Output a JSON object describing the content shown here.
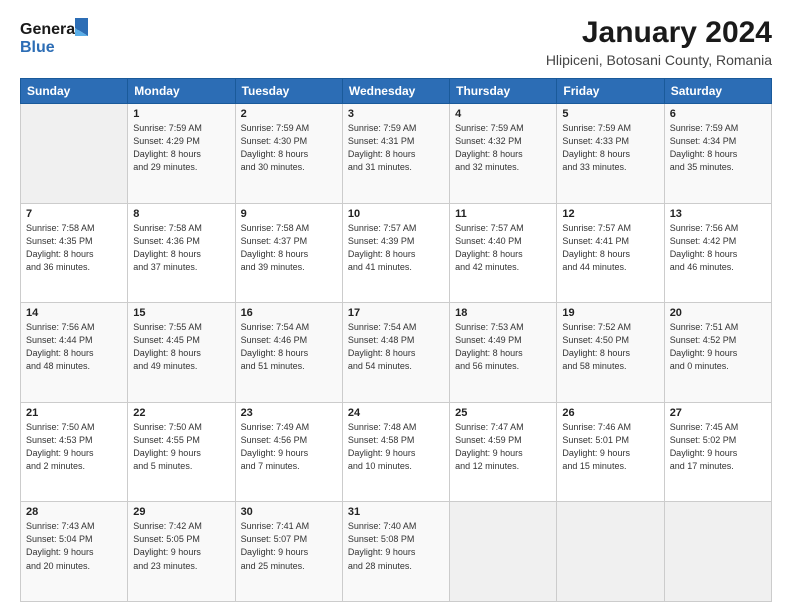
{
  "logo": {
    "line1": "General",
    "line2": "Blue"
  },
  "title": "January 2024",
  "subtitle": "Hlipiceni, Botosani County, Romania",
  "weekdays": [
    "Sunday",
    "Monday",
    "Tuesday",
    "Wednesday",
    "Thursday",
    "Friday",
    "Saturday"
  ],
  "weeks": [
    [
      {
        "day": "",
        "info": ""
      },
      {
        "day": "1",
        "info": "Sunrise: 7:59 AM\nSunset: 4:29 PM\nDaylight: 8 hours\nand 29 minutes."
      },
      {
        "day": "2",
        "info": "Sunrise: 7:59 AM\nSunset: 4:30 PM\nDaylight: 8 hours\nand 30 minutes."
      },
      {
        "day": "3",
        "info": "Sunrise: 7:59 AM\nSunset: 4:31 PM\nDaylight: 8 hours\nand 31 minutes."
      },
      {
        "day": "4",
        "info": "Sunrise: 7:59 AM\nSunset: 4:32 PM\nDaylight: 8 hours\nand 32 minutes."
      },
      {
        "day": "5",
        "info": "Sunrise: 7:59 AM\nSunset: 4:33 PM\nDaylight: 8 hours\nand 33 minutes."
      },
      {
        "day": "6",
        "info": "Sunrise: 7:59 AM\nSunset: 4:34 PM\nDaylight: 8 hours\nand 35 minutes."
      }
    ],
    [
      {
        "day": "7",
        "info": "Sunrise: 7:58 AM\nSunset: 4:35 PM\nDaylight: 8 hours\nand 36 minutes."
      },
      {
        "day": "8",
        "info": "Sunrise: 7:58 AM\nSunset: 4:36 PM\nDaylight: 8 hours\nand 37 minutes."
      },
      {
        "day": "9",
        "info": "Sunrise: 7:58 AM\nSunset: 4:37 PM\nDaylight: 8 hours\nand 39 minutes."
      },
      {
        "day": "10",
        "info": "Sunrise: 7:57 AM\nSunset: 4:39 PM\nDaylight: 8 hours\nand 41 minutes."
      },
      {
        "day": "11",
        "info": "Sunrise: 7:57 AM\nSunset: 4:40 PM\nDaylight: 8 hours\nand 42 minutes."
      },
      {
        "day": "12",
        "info": "Sunrise: 7:57 AM\nSunset: 4:41 PM\nDaylight: 8 hours\nand 44 minutes."
      },
      {
        "day": "13",
        "info": "Sunrise: 7:56 AM\nSunset: 4:42 PM\nDaylight: 8 hours\nand 46 minutes."
      }
    ],
    [
      {
        "day": "14",
        "info": "Sunrise: 7:56 AM\nSunset: 4:44 PM\nDaylight: 8 hours\nand 48 minutes."
      },
      {
        "day": "15",
        "info": "Sunrise: 7:55 AM\nSunset: 4:45 PM\nDaylight: 8 hours\nand 49 minutes."
      },
      {
        "day": "16",
        "info": "Sunrise: 7:54 AM\nSunset: 4:46 PM\nDaylight: 8 hours\nand 51 minutes."
      },
      {
        "day": "17",
        "info": "Sunrise: 7:54 AM\nSunset: 4:48 PM\nDaylight: 8 hours\nand 54 minutes."
      },
      {
        "day": "18",
        "info": "Sunrise: 7:53 AM\nSunset: 4:49 PM\nDaylight: 8 hours\nand 56 minutes."
      },
      {
        "day": "19",
        "info": "Sunrise: 7:52 AM\nSunset: 4:50 PM\nDaylight: 8 hours\nand 58 minutes."
      },
      {
        "day": "20",
        "info": "Sunrise: 7:51 AM\nSunset: 4:52 PM\nDaylight: 9 hours\nand 0 minutes."
      }
    ],
    [
      {
        "day": "21",
        "info": "Sunrise: 7:50 AM\nSunset: 4:53 PM\nDaylight: 9 hours\nand 2 minutes."
      },
      {
        "day": "22",
        "info": "Sunrise: 7:50 AM\nSunset: 4:55 PM\nDaylight: 9 hours\nand 5 minutes."
      },
      {
        "day": "23",
        "info": "Sunrise: 7:49 AM\nSunset: 4:56 PM\nDaylight: 9 hours\nand 7 minutes."
      },
      {
        "day": "24",
        "info": "Sunrise: 7:48 AM\nSunset: 4:58 PM\nDaylight: 9 hours\nand 10 minutes."
      },
      {
        "day": "25",
        "info": "Sunrise: 7:47 AM\nSunset: 4:59 PM\nDaylight: 9 hours\nand 12 minutes."
      },
      {
        "day": "26",
        "info": "Sunrise: 7:46 AM\nSunset: 5:01 PM\nDaylight: 9 hours\nand 15 minutes."
      },
      {
        "day": "27",
        "info": "Sunrise: 7:45 AM\nSunset: 5:02 PM\nDaylight: 9 hours\nand 17 minutes."
      }
    ],
    [
      {
        "day": "28",
        "info": "Sunrise: 7:43 AM\nSunset: 5:04 PM\nDaylight: 9 hours\nand 20 minutes."
      },
      {
        "day": "29",
        "info": "Sunrise: 7:42 AM\nSunset: 5:05 PM\nDaylight: 9 hours\nand 23 minutes."
      },
      {
        "day": "30",
        "info": "Sunrise: 7:41 AM\nSunset: 5:07 PM\nDaylight: 9 hours\nand 25 minutes."
      },
      {
        "day": "31",
        "info": "Sunrise: 7:40 AM\nSunset: 5:08 PM\nDaylight: 9 hours\nand 28 minutes."
      },
      {
        "day": "",
        "info": ""
      },
      {
        "day": "",
        "info": ""
      },
      {
        "day": "",
        "info": ""
      }
    ]
  ]
}
